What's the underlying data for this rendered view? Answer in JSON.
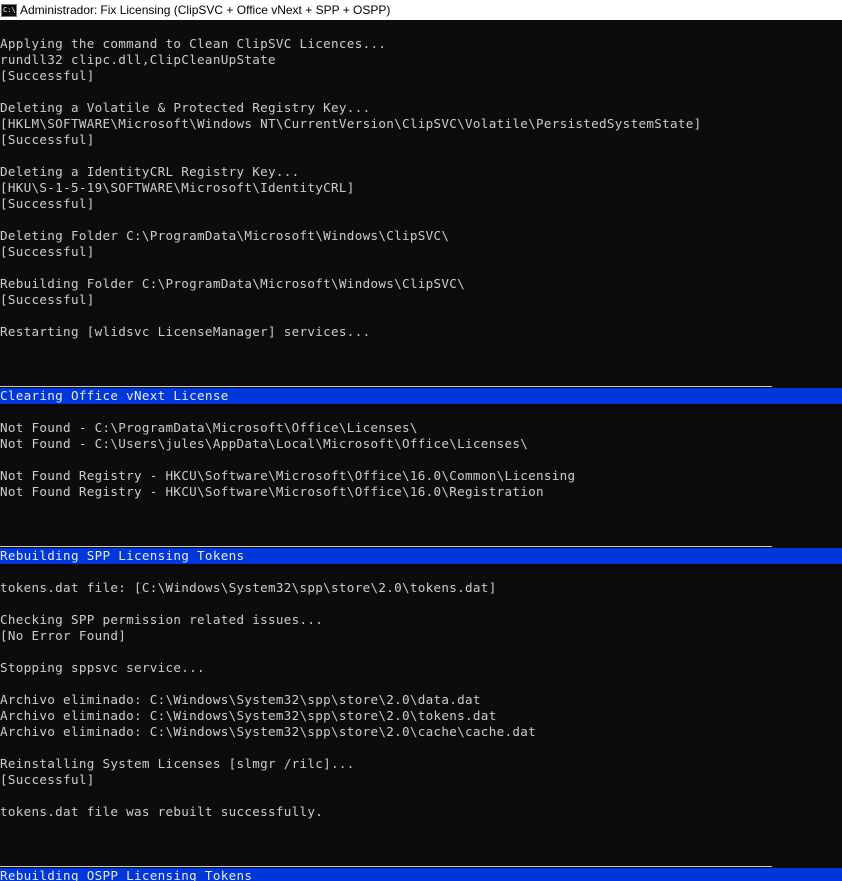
{
  "window": {
    "title_prefix": "Administrador:",
    "title": "Fix Licensing (ClipSVC + Office vNext + SPP + OSPP)",
    "icon_glyph": "C:\\"
  },
  "console": {
    "lines": [
      {
        "type": "text",
        "text": "Applying the command to Clean ClipSVC Licences..."
      },
      {
        "type": "text",
        "text": "rundll32 clipc.dll,ClipCleanUpState"
      },
      {
        "type": "text",
        "text": "[Successful]"
      },
      {
        "type": "blank",
        "text": ""
      },
      {
        "type": "text",
        "text": "Deleting a Volatile & Protected Registry Key..."
      },
      {
        "type": "text",
        "text": "[HKLM\\SOFTWARE\\Microsoft\\Windows NT\\CurrentVersion\\ClipSVC\\Volatile\\PersistedSystemState]"
      },
      {
        "type": "text",
        "text": "[Successful]"
      },
      {
        "type": "blank",
        "text": ""
      },
      {
        "type": "text",
        "text": "Deleting a IdentityCRL Registry Key..."
      },
      {
        "type": "text",
        "text": "[HKU\\S-1-5-19\\SOFTWARE\\Microsoft\\IdentityCRL]"
      },
      {
        "type": "text",
        "text": "[Successful]"
      },
      {
        "type": "blank",
        "text": ""
      },
      {
        "type": "text",
        "text": "Deleting Folder C:\\ProgramData\\Microsoft\\Windows\\ClipSVC\\"
      },
      {
        "type": "text",
        "text": "[Successful]"
      },
      {
        "type": "blank",
        "text": ""
      },
      {
        "type": "text",
        "text": "Rebuilding Folder C:\\ProgramData\\Microsoft\\Windows\\ClipSVC\\"
      },
      {
        "type": "text",
        "text": "[Successful]"
      },
      {
        "type": "blank",
        "text": ""
      },
      {
        "type": "text",
        "text": "Restarting [wlidsvc LicenseManager] services..."
      },
      {
        "type": "blank",
        "text": ""
      },
      {
        "type": "blank",
        "text": ""
      },
      {
        "type": "separator",
        "text": ""
      },
      {
        "type": "header",
        "text": "Clearing Office vNext License"
      },
      {
        "type": "blank",
        "text": ""
      },
      {
        "type": "text",
        "text": "Not Found - C:\\ProgramData\\Microsoft\\Office\\Licenses\\"
      },
      {
        "type": "text",
        "text": "Not Found - C:\\Users\\jules\\AppData\\Local\\Microsoft\\Office\\Licenses\\"
      },
      {
        "type": "blank",
        "text": ""
      },
      {
        "type": "text",
        "text": "Not Found Registry - HKCU\\Software\\Microsoft\\Office\\16.0\\Common\\Licensing"
      },
      {
        "type": "text",
        "text": "Not Found Registry - HKCU\\Software\\Microsoft\\Office\\16.0\\Registration"
      },
      {
        "type": "blank",
        "text": ""
      },
      {
        "type": "blank",
        "text": ""
      },
      {
        "type": "separator",
        "text": ""
      },
      {
        "type": "header",
        "text": "Rebuilding SPP Licensing Tokens"
      },
      {
        "type": "blank",
        "text": ""
      },
      {
        "type": "text",
        "text": "tokens.dat file: [C:\\Windows\\System32\\spp\\store\\2.0\\tokens.dat]"
      },
      {
        "type": "blank",
        "text": ""
      },
      {
        "type": "text",
        "text": "Checking SPP permission related issues..."
      },
      {
        "type": "text",
        "text": "[No Error Found]"
      },
      {
        "type": "blank",
        "text": ""
      },
      {
        "type": "text",
        "text": "Stopping sppsvc service..."
      },
      {
        "type": "blank",
        "text": ""
      },
      {
        "type": "text",
        "text": "Archivo eliminado: C:\\Windows\\System32\\spp\\store\\2.0\\data.dat"
      },
      {
        "type": "text",
        "text": "Archivo eliminado: C:\\Windows\\System32\\spp\\store\\2.0\\tokens.dat"
      },
      {
        "type": "text",
        "text": "Archivo eliminado: C:\\Windows\\System32\\spp\\store\\2.0\\cache\\cache.dat"
      },
      {
        "type": "blank",
        "text": ""
      },
      {
        "type": "text",
        "text": "Reinstalling System Licenses [slmgr /rilc]..."
      },
      {
        "type": "text",
        "text": "[Successful]"
      },
      {
        "type": "blank",
        "text": ""
      },
      {
        "type": "text",
        "text": "tokens.dat file was rebuilt successfully."
      },
      {
        "type": "blank",
        "text": ""
      },
      {
        "type": "blank",
        "text": ""
      },
      {
        "type": "separator",
        "text": ""
      },
      {
        "type": "header",
        "text": "Rebuilding OSPP Licensing Tokens"
      }
    ]
  },
  "colors": {
    "background": "#0c0c0c",
    "foreground": "#cccccc",
    "header_background": "#0037da",
    "titlebar_background": "#ffffff"
  }
}
